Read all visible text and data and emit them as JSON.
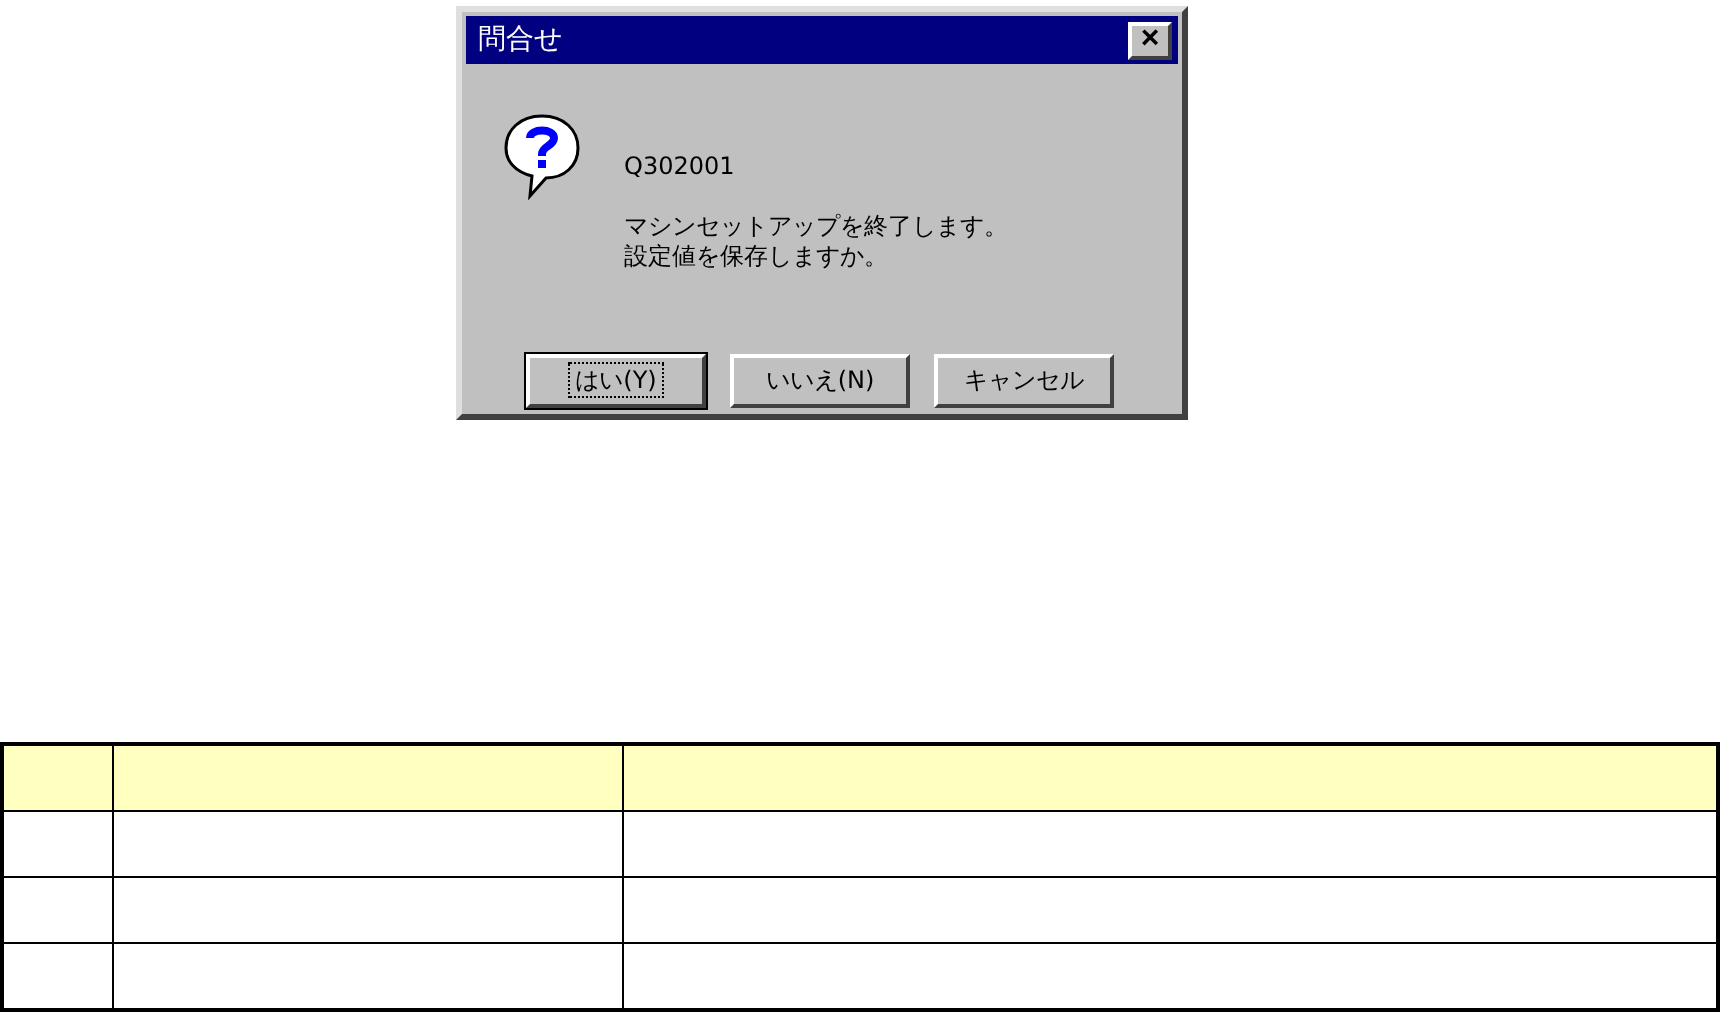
{
  "dialog": {
    "title": "問合せ",
    "close": "×",
    "code": "Q302001",
    "message": [
      "マシンセットアップを終了します。",
      "設定値を保存しますか。"
    ],
    "buttons": [
      {
        "label": "はい(Y)",
        "default": true
      },
      {
        "label": "いいえ(N)",
        "default": false
      },
      {
        "label": "キャンセル",
        "default": false
      }
    ]
  },
  "table": {
    "rows": [
      {
        "kind": "header"
      },
      {
        "kind": "body"
      },
      {
        "kind": "body"
      },
      {
        "kind": "body"
      }
    ]
  }
}
